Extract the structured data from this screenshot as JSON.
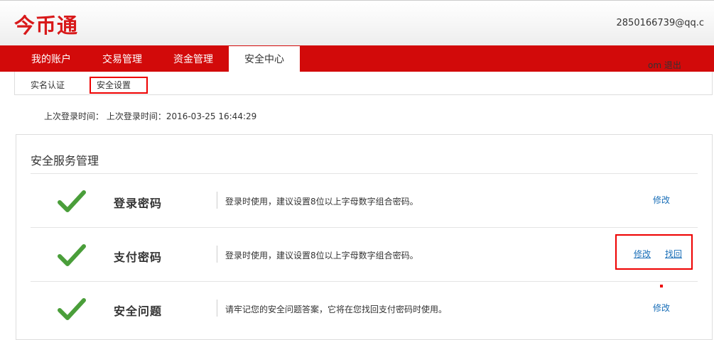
{
  "header": {
    "logo": "今币通",
    "user_email": "2850166739@qq.c"
  },
  "nav": {
    "tabs": [
      {
        "label": "我的账户"
      },
      {
        "label": "交易管理"
      },
      {
        "label": "资金管理"
      },
      {
        "label": "安全中心",
        "active": true
      }
    ],
    "logout": "om 退出"
  },
  "subnav": {
    "items": [
      {
        "label": "实名认证"
      },
      {
        "label": "安全设置",
        "active": true
      }
    ]
  },
  "last_login": "上次登录时间： 上次登录时间：2016-03-25 16:44:29",
  "panel": {
    "title": "安全服务管理",
    "rows": [
      {
        "name": "登录密码",
        "desc": "登录时使用，建议设置8位以上字母数字组合密码。",
        "actions": [
          "修改"
        ]
      },
      {
        "name": "支付密码",
        "desc": "登录时使用，建议设置8位以上字母数字组合密码。",
        "actions": [
          "修改",
          "找回"
        ]
      },
      {
        "name": "安全问题",
        "desc": "请牢记您的安全问题答案，它将在您找回支付密码时使用。",
        "actions": [
          "修改"
        ]
      }
    ]
  },
  "colors": {
    "brand_red": "#d20a0a",
    "check_green": "#4a9e3a",
    "link_blue": "#1a6fb8",
    "annotation_red": "#ee0000"
  },
  "icons": {
    "status": "check-icon"
  }
}
